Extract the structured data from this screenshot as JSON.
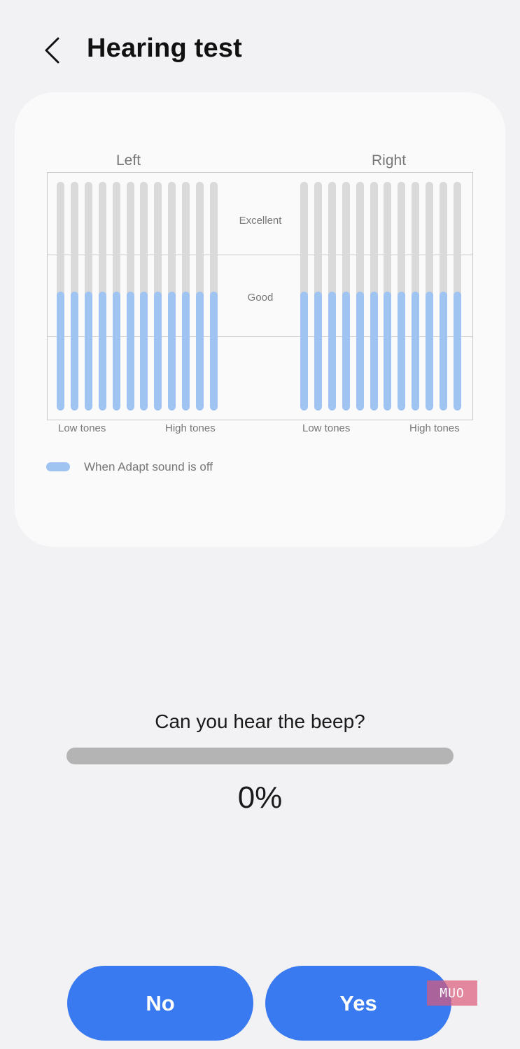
{
  "header": {
    "title": "Hearing test",
    "back_icon": "chevron-left-icon"
  },
  "graph": {
    "sides": [
      {
        "label": "Left",
        "low_label": "Low tones",
        "high_label": "High tones"
      },
      {
        "label": "Right",
        "low_label": "Low tones",
        "high_label": "High tones"
      }
    ],
    "bands": [
      "Excellent",
      "Good"
    ],
    "bars_per_side": 12,
    "bar_level_fraction": 0.52,
    "legend": "When Adapt sound is off",
    "colors": {
      "track": "#dadada",
      "fill": "#9fc4f1"
    }
  },
  "question": "Can you hear the beep?",
  "progress": {
    "value": 0,
    "label": "0%"
  },
  "buttons": {
    "no": "No",
    "yes": "Yes"
  },
  "watermark": "MUO",
  "colors": {
    "accent": "#3a7af0",
    "background": "#f2f2f4",
    "card": "#fafafa"
  }
}
